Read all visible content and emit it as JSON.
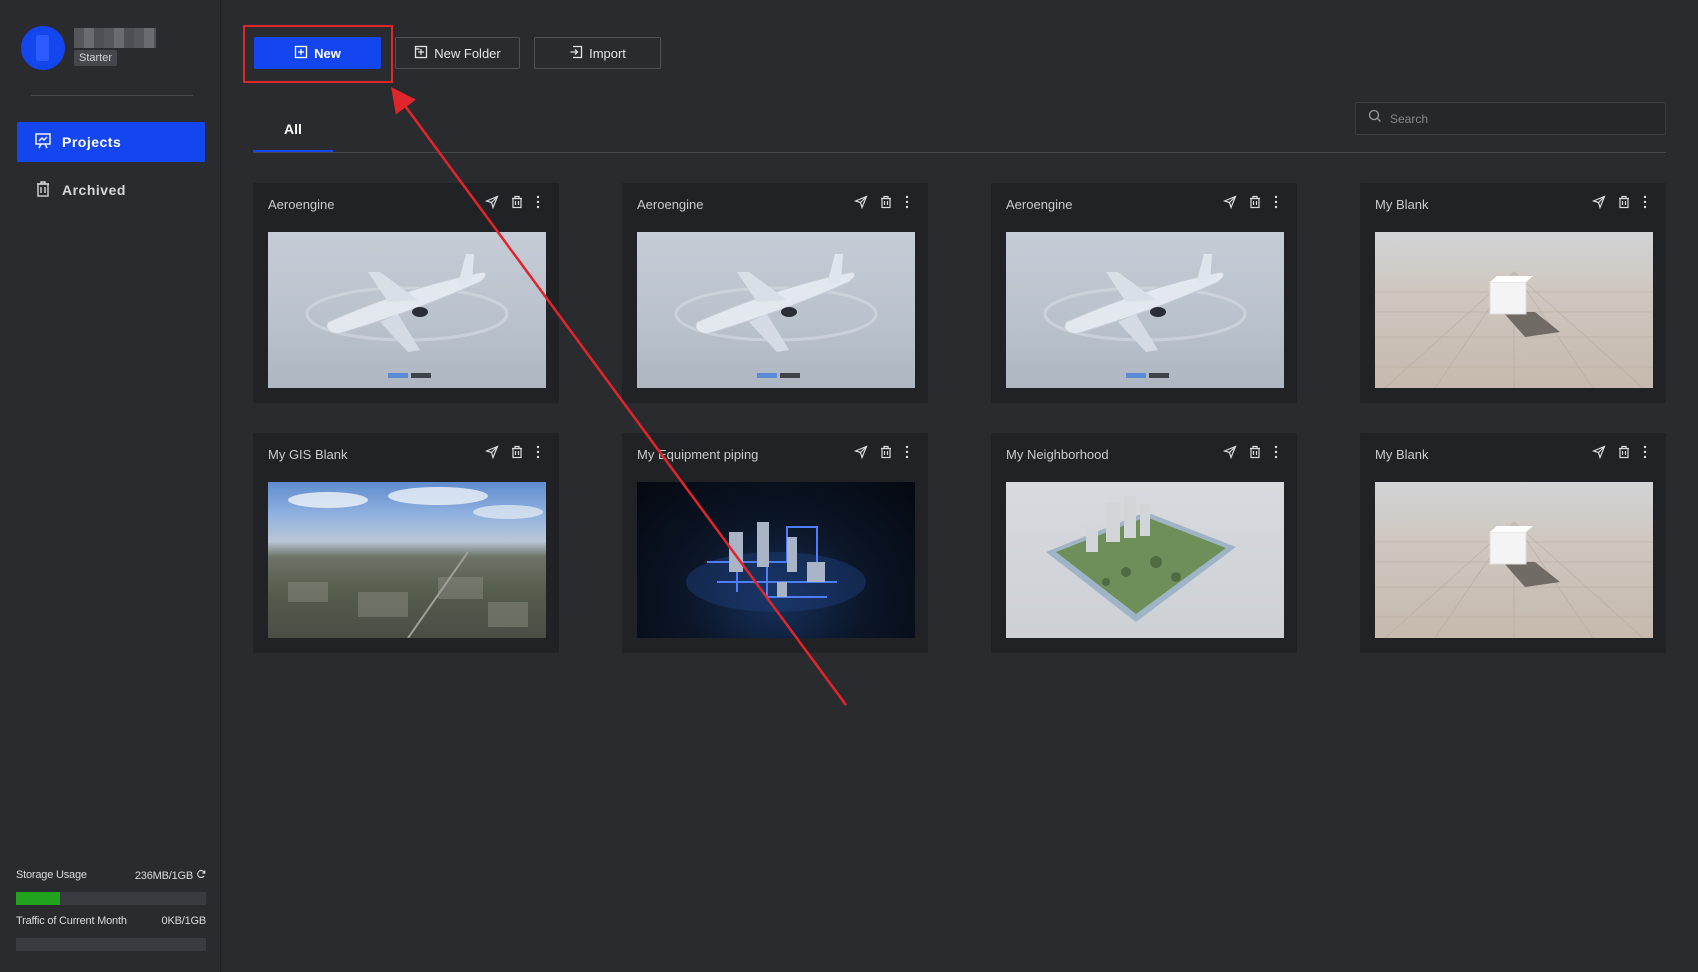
{
  "user": {
    "plan": "Starter"
  },
  "sidebar": {
    "items": [
      {
        "label": "Projects",
        "icon": "presentation-chart-icon",
        "active": true
      },
      {
        "label": "Archived",
        "icon": "trash-icon",
        "active": false
      }
    ],
    "storage": {
      "label": "Storage Usage",
      "value": "236MB/1GB",
      "percent": 23
    },
    "traffic": {
      "label": "Traffic of Current Month",
      "value": "0KB/1GB",
      "percent": 0
    }
  },
  "toolbar": {
    "new_label": "New",
    "new_folder_label": "New Folder",
    "import_label": "Import"
  },
  "tabs": {
    "all_label": "All"
  },
  "search": {
    "placeholder": "Search"
  },
  "projects": [
    {
      "title": "Aeroengine",
      "thumb": "airplane"
    },
    {
      "title": "Aeroengine",
      "thumb": "airplane"
    },
    {
      "title": "Aeroengine",
      "thumb": "airplane"
    },
    {
      "title": "My Blank",
      "thumb": "blank-scene"
    },
    {
      "title": "My GIS Blank",
      "thumb": "aerial-city"
    },
    {
      "title": "My Equipment piping",
      "thumb": "equipment-piping"
    },
    {
      "title": "My Neighborhood",
      "thumb": "neighborhood-model"
    },
    {
      "title": "My Blank",
      "thumb": "blank-scene"
    }
  ],
  "colors": {
    "accent": "#1446f0",
    "annotation": "#e0262b",
    "storage_fill": "#21a31f"
  }
}
